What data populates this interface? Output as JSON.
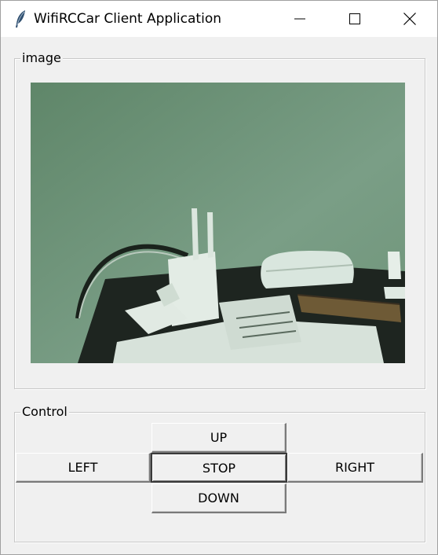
{
  "window": {
    "title": "WifiRCCar Client Application",
    "icon": "feather-icon",
    "controls": [
      "minimize-icon",
      "maximize-icon",
      "close-icon"
    ]
  },
  "image_group": {
    "label": "image",
    "content": "camera-feed"
  },
  "control_group": {
    "label": "Control",
    "buttons": {
      "up": "UP",
      "left": "LEFT",
      "stop": "STOP",
      "right": "RIGHT",
      "down": "DOWN"
    }
  }
}
